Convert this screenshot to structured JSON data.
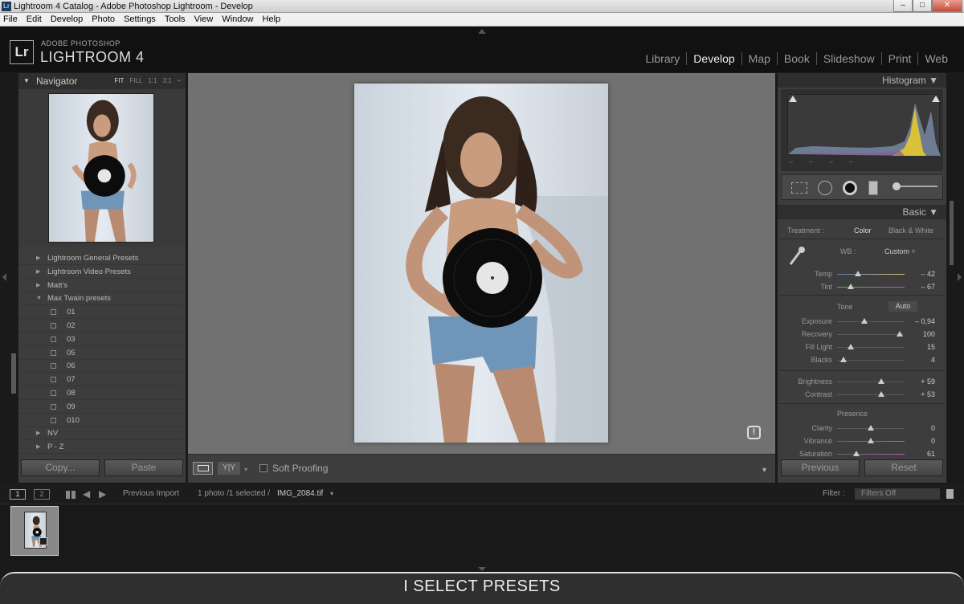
{
  "window": {
    "title": "Lightroom 4 Catalog - Adobe Photoshop Lightroom - Develop",
    "app_icon": "Lr"
  },
  "menu": [
    "File",
    "Edit",
    "Develop",
    "Photo",
    "Settings",
    "Tools",
    "View",
    "Window",
    "Help"
  ],
  "brand": {
    "logo": "Lr",
    "adobe": "ADOBE PHOTOSHOP",
    "product": "LIGHTROOM 4"
  },
  "modules": [
    "Library",
    "Develop",
    "Map",
    "Book",
    "Slideshow",
    "Print",
    "Web"
  ],
  "navigator": {
    "title": "Navigator",
    "zoom": [
      "FIT",
      "FILL",
      "1:1",
      "3:1"
    ]
  },
  "presets": [
    {
      "label": "Lightroom General Presets",
      "type": "folder"
    },
    {
      "label": "Lightroom Video Presets",
      "type": "folder"
    },
    {
      "label": "Matt's",
      "type": "folder"
    },
    {
      "label": "Max Twain presets",
      "type": "open"
    },
    {
      "label": "01",
      "type": "item"
    },
    {
      "label": "02",
      "type": "item"
    },
    {
      "label": "03",
      "type": "item"
    },
    {
      "label": "05",
      "type": "item"
    },
    {
      "label": "06",
      "type": "item"
    },
    {
      "label": "07",
      "type": "item"
    },
    {
      "label": "08",
      "type": "item"
    },
    {
      "label": "09",
      "type": "item"
    },
    {
      "label": "010",
      "type": "item"
    },
    {
      "label": "NV",
      "type": "folder"
    },
    {
      "label": "P - Z",
      "type": "folder"
    }
  ],
  "left_buttons": {
    "copy": "Copy...",
    "paste": "Paste"
  },
  "toolbar": {
    "soft_proofing": "Soft Proofing",
    "yy": "Y|Y"
  },
  "histogram": {
    "title": "Histogram",
    "dashes": "–        –        –        –"
  },
  "basic": {
    "title": "Basic",
    "treatment_label": "Treatment :",
    "treatment_color": "Color",
    "treatment_bw": "Black & White",
    "wb_label": "WB :",
    "wb_value": "Custom ÷",
    "tone_label": "Tone",
    "auto": "Auto",
    "presence_label": "Presence",
    "sliders": [
      {
        "label": "Temp",
        "value": "– 42"
      },
      {
        "label": "Tint",
        "value": "– 67"
      },
      {
        "label": "Exposure",
        "value": "– 0,94"
      },
      {
        "label": "Recovery",
        "value": "100"
      },
      {
        "label": "Fill Light",
        "value": "15"
      },
      {
        "label": "Blacks",
        "value": "4"
      },
      {
        "label": "Brightness",
        "value": "+ 59"
      },
      {
        "label": "Contrast",
        "value": "+ 53"
      },
      {
        "label": "Clarity",
        "value": "0"
      },
      {
        "label": "Vibrance",
        "value": "0"
      },
      {
        "label": "Saturation",
        "value": "61"
      }
    ]
  },
  "right_buttons": {
    "previous": "Previous",
    "reset": "Reset"
  },
  "filmstrip": {
    "screen1": "1",
    "screen2": "2",
    "source": "Previous Import",
    "count": "1 photo /1 selected /",
    "filename": "IMG_2084.tif",
    "filter_label": "Filter :",
    "filter_value": "Filters Off"
  },
  "caption": "I SELECT PRESETS",
  "colors": {
    "accent_bg": "#3d3d3d",
    "center_bg": "#717171"
  }
}
